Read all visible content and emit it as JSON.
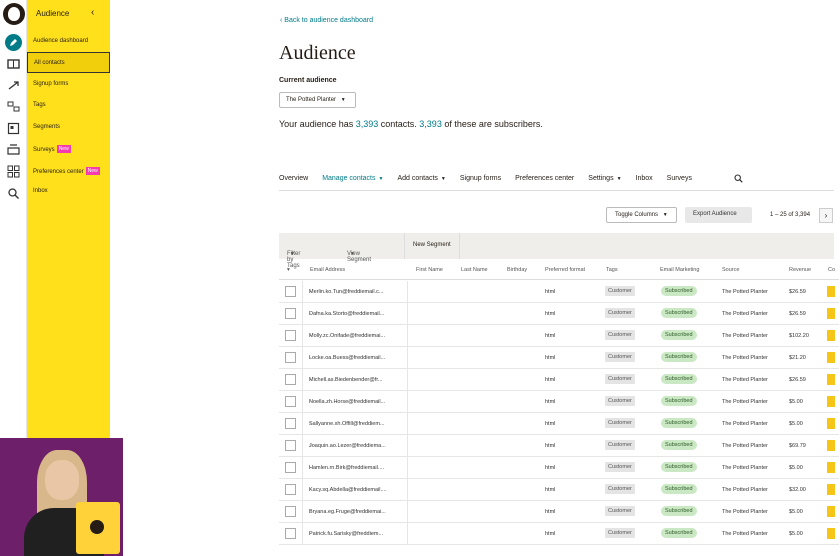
{
  "nav": {
    "header": "Audience",
    "items": [
      {
        "label": "Audience dashboard"
      },
      {
        "label": "All contacts"
      },
      {
        "label": "Signup forms"
      },
      {
        "label": "Tags"
      },
      {
        "label": "Segments"
      },
      {
        "label": "Surveys",
        "badge": "New"
      },
      {
        "label": "Preferences center",
        "badge": "New"
      },
      {
        "label": "Inbox"
      }
    ]
  },
  "page": {
    "back_link": "Back to audience dashboard",
    "title": "Audience",
    "current_audience_label": "Current audience",
    "audience_select": "The Potted Planter",
    "summary_prefix": "Your audience has ",
    "contacts_count": "3,393",
    "summary_mid": " contacts. ",
    "subscribers_count": "3,393",
    "summary_suffix": " of these are subscribers."
  },
  "tabs": [
    "Overview",
    "Manage contacts",
    "Add contacts",
    "Signup forms",
    "Preferences center",
    "Settings",
    "Inbox",
    "Surveys"
  ],
  "toolbar": {
    "toggle_columns": "Toggle Columns",
    "export": "Export Audience",
    "pagination": "1 – 25 of 3,394"
  },
  "filters": {
    "filter_by_tags": "Filter by Tags",
    "view_segment": "View Segment",
    "new_segment": "New Segment"
  },
  "table": {
    "columns": [
      "Email Address",
      "First Name",
      "Last Name",
      "Birthday",
      "Preferred format",
      "Tags",
      "Email Marketing",
      "Source",
      "Revenue",
      "Co"
    ],
    "rows": [
      {
        "email": "Merlin.ko.Tun@freddiemail.c...",
        "format": "html",
        "tag": "Customer",
        "status": "Subscribed",
        "source": "The Potted Planter",
        "revenue": "$26.59"
      },
      {
        "email": "Dafna.ka.Storto@freddiemail...",
        "format": "html",
        "tag": "Customer",
        "status": "Subscribed",
        "source": "The Potted Planter",
        "revenue": "$26.59"
      },
      {
        "email": "Molly.zc.Onifade@freddiemai...",
        "format": "html",
        "tag": "Customer",
        "status": "Subscribed",
        "source": "The Potted Planter",
        "revenue": "$102.20"
      },
      {
        "email": "Locke.oa.Buess@freddiemail...",
        "format": "html",
        "tag": "Customer",
        "status": "Subscribed",
        "source": "The Potted Planter",
        "revenue": "$21.20"
      },
      {
        "email": "Michell.as.Biedenbender@fr...",
        "format": "html",
        "tag": "Customer",
        "status": "Subscribed",
        "source": "The Potted Planter",
        "revenue": "$26.59"
      },
      {
        "email": "Noella.zh.Horse@freddiemail...",
        "format": "html",
        "tag": "Customer",
        "status": "Subscribed",
        "source": "The Potted Planter",
        "revenue": "$5.00"
      },
      {
        "email": "Sallyanne.xh.Offill@freddiem...",
        "format": "html",
        "tag": "Customer",
        "status": "Subscribed",
        "source": "The Potted Planter",
        "revenue": "$5.00"
      },
      {
        "email": "Joaquin.ao.Lezer@freddiema...",
        "format": "html",
        "tag": "Customer",
        "status": "Subscribed",
        "source": "The Potted Planter",
        "revenue": "$69.79"
      },
      {
        "email": "Hamlen.rn.Birk@freddiemail....",
        "format": "html",
        "tag": "Customer",
        "status": "Subscribed",
        "source": "The Potted Planter",
        "revenue": "$5.00"
      },
      {
        "email": "Kacy.sq.Abdella@freddiemail....",
        "format": "html",
        "tag": "Customer",
        "status": "Subscribed",
        "source": "The Potted Planter",
        "revenue": "$32.00"
      },
      {
        "email": "Bryana.eg.Fruge@freddiemai...",
        "format": "html",
        "tag": "Customer",
        "status": "Subscribed",
        "source": "The Potted Planter",
        "revenue": "$5.00"
      },
      {
        "email": "Patrick.fu.Sarisky@freddiem...",
        "format": "html",
        "tag": "Customer",
        "status": "Subscribed",
        "source": "The Potted Planter",
        "revenue": "$5.00"
      }
    ]
  },
  "colors": {
    "accent": "#007c89",
    "nav_bg": "#ffe01b",
    "badge": "#f43bb1",
    "subscribed_bg": "#c9e8c3"
  }
}
